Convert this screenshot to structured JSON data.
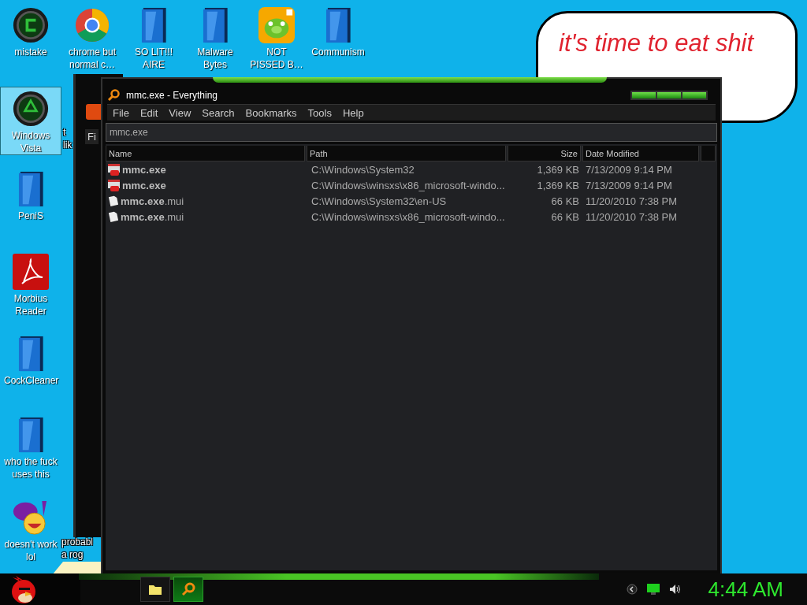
{
  "desktop": {
    "icons": [
      {
        "label": "mistake",
        "kind": "disc",
        "selected": false
      },
      {
        "label": "chrome but normal c…",
        "kind": "ring",
        "selected": false
      },
      {
        "label": "SO LIT!!! AIRE",
        "kind": "book",
        "selected": false
      },
      {
        "label": "Malware Bytes",
        "kind": "book",
        "selected": false
      },
      {
        "label": "NOT PISSED B…",
        "kind": "pig",
        "selected": false
      },
      {
        "label": "Communism",
        "kind": "book",
        "selected": false
      },
      {
        "label": "Windows Vista",
        "kind": "recycle",
        "selected": true
      },
      {
        "label": "t lik",
        "kind": "hidden",
        "selected": false
      },
      {
        "label": "PeniS",
        "kind": "book",
        "selected": false
      },
      {
        "label": "Morbius Reader",
        "kind": "swirl",
        "selected": false
      },
      {
        "label": "CockCleaner",
        "kind": "book",
        "selected": false
      },
      {
        "label": "who the fuck uses this",
        "kind": "book",
        "selected": false
      },
      {
        "label": "doesn't work lol",
        "kind": "smiley",
        "selected": false
      },
      {
        "label": "probabl a rog",
        "kind": "hidden",
        "selected": false
      }
    ],
    "speech_bubble": {
      "lines": [
        "it's time to eat shit"
      ]
    }
  },
  "background_window": {
    "tab_label": "Fi"
  },
  "window": {
    "title": "mmc.exe - Everything",
    "menu": [
      "File",
      "Edit",
      "View",
      "Search",
      "Bookmarks",
      "Tools",
      "Help"
    ],
    "search": {
      "value": "mmc.exe"
    },
    "columns": [
      "Name",
      "Path",
      "Size",
      "Date Modified"
    ],
    "rows": [
      {
        "kind": "exe",
        "name": "**mmc.exe**",
        "path": "C:\\Windows\\System32",
        "size": "1,369 KB",
        "date": "7/13/2009 9:14 PM"
      },
      {
        "kind": "exe",
        "name": "**mmc.exe**",
        "path": "C:\\Windows\\winsxs\\x86_microsoft-windo...",
        "size": "1,369 KB",
        "date": "7/13/2009 9:14 PM"
      },
      {
        "kind": "file",
        "name": "**mmc.exe**.mui",
        "path": "C:\\Windows\\System32\\en-US",
        "size": "66 KB",
        "date": "11/20/2010 7:38 PM"
      },
      {
        "kind": "file",
        "name": "**mmc.exe**.mui",
        "path": "C:\\Windows\\winsxs\\x86_microsoft-windo...",
        "size": "66 KB",
        "date": "11/20/2010 7:38 PM"
      }
    ]
  },
  "taskbar": {
    "buttons": [
      {
        "kind": "folder",
        "selected": false
      },
      {
        "kind": "search",
        "selected": true
      }
    ],
    "clock": "4:44 AM"
  }
}
